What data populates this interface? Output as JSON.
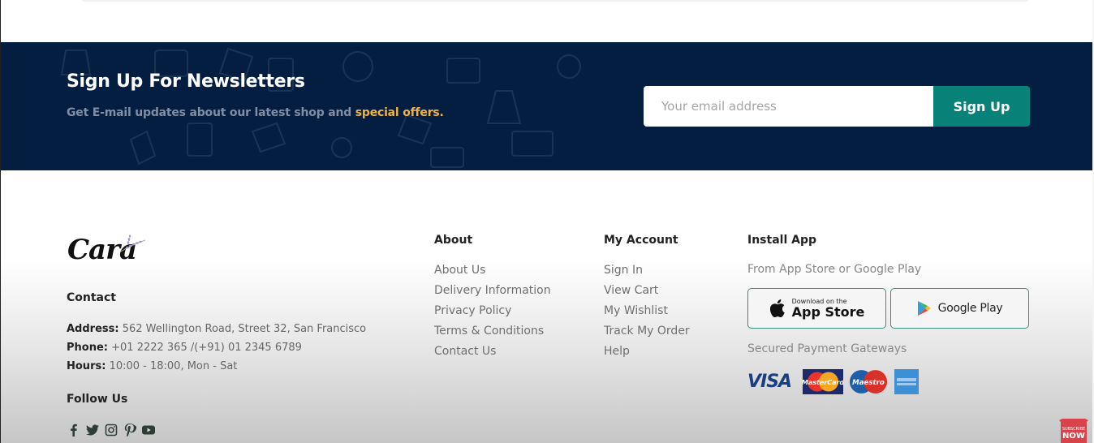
{
  "newsletter": {
    "title": "Sign Up For Newsletters",
    "subtitle_prefix": "Get E-mail updates about our latest shop and ",
    "subtitle_highlight": "special offers.",
    "email_placeholder": "Your email address",
    "email_value": "",
    "button_label": "Sign Up",
    "colors": {
      "background": "#041e42",
      "highlight": "#f0b442",
      "button": "#088178"
    }
  },
  "footer": {
    "logo_text": "Cara",
    "contact": {
      "title": "Contact",
      "address_label": "Address:",
      "address_value": "562 Wellington Road, Street 32, San Francisco",
      "phone_label": "Phone:",
      "phone_value": "+01 2222 365 /(+91) 01 2345 6789",
      "hours_label": "Hours:",
      "hours_value": "10:00 - 18:00, Mon - Sat"
    },
    "follow": {
      "title": "Follow Us",
      "icons": [
        "facebook-icon",
        "twitter-icon",
        "instagram-icon",
        "pinterest-icon",
        "youtube-icon"
      ]
    },
    "about": {
      "title": "About",
      "links": [
        "About Us",
        "Delivery Information",
        "Privacy Policy",
        "Terms & Conditions",
        "Contact Us"
      ]
    },
    "account": {
      "title": "My Account",
      "links": [
        "Sign In",
        "View Cart",
        "My Wishlist",
        "Track My Order",
        "Help"
      ]
    },
    "install": {
      "title": "Install App",
      "subtitle": "From App Store or Google Play",
      "app_store_small": "Download on the",
      "app_store_big": "App Store",
      "google_play": "Google Play",
      "payment_title": "Secured Payment Gateways",
      "payment_methods": [
        "VISA",
        "MasterCard",
        "Maestro",
        "American Express"
      ]
    }
  },
  "overlay": {
    "subscribe_badge_top": "SUBSCRIBE",
    "subscribe_badge_bottom": "NOW"
  }
}
